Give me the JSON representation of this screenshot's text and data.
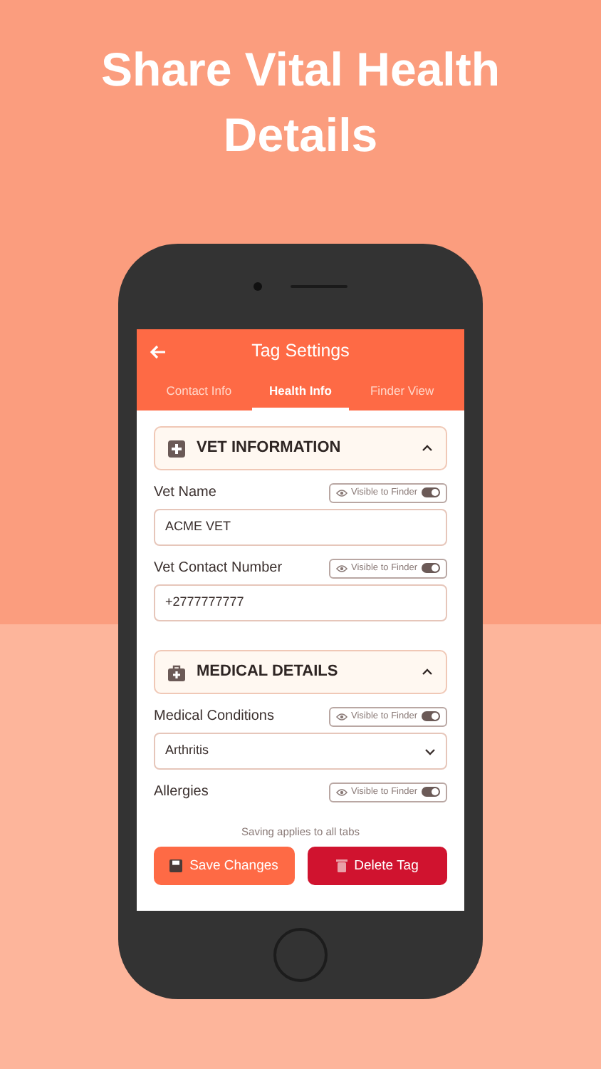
{
  "headline": "Share Vital Health Details",
  "screen": {
    "title": "Tag Settings",
    "tabs": [
      {
        "label": "Contact Info",
        "selected": false
      },
      {
        "label": "Health Info",
        "selected": true
      },
      {
        "label": "Finder View",
        "selected": false
      }
    ],
    "sections": [
      {
        "kind": "vet",
        "title": "VET INFORMATION",
        "expanded": true,
        "fields": [
          {
            "kind": "text",
            "label": "Vet Name",
            "visibility": "Visible to Finder",
            "on": true,
            "value": "ACME VET"
          },
          {
            "kind": "text",
            "label": "Vet Contact Number",
            "visibility": "Visible to Finder",
            "on": true,
            "value": "+2777777777"
          }
        ]
      },
      {
        "kind": "medical",
        "title": "MEDICAL DETAILS",
        "expanded": true,
        "fields": [
          {
            "kind": "select",
            "label": "Medical Conditions",
            "visibility": "Visible to Finder",
            "on": true,
            "value": "Arthritis"
          },
          {
            "label": "Allergies",
            "visibility": "Visible to Finder",
            "on": true
          }
        ]
      }
    ],
    "note": "Saving applies to all tabs",
    "buttons": [
      {
        "kind": "save",
        "label": "Save Changes"
      },
      {
        "kind": "delete",
        "label": "Delete Tag"
      }
    ]
  }
}
